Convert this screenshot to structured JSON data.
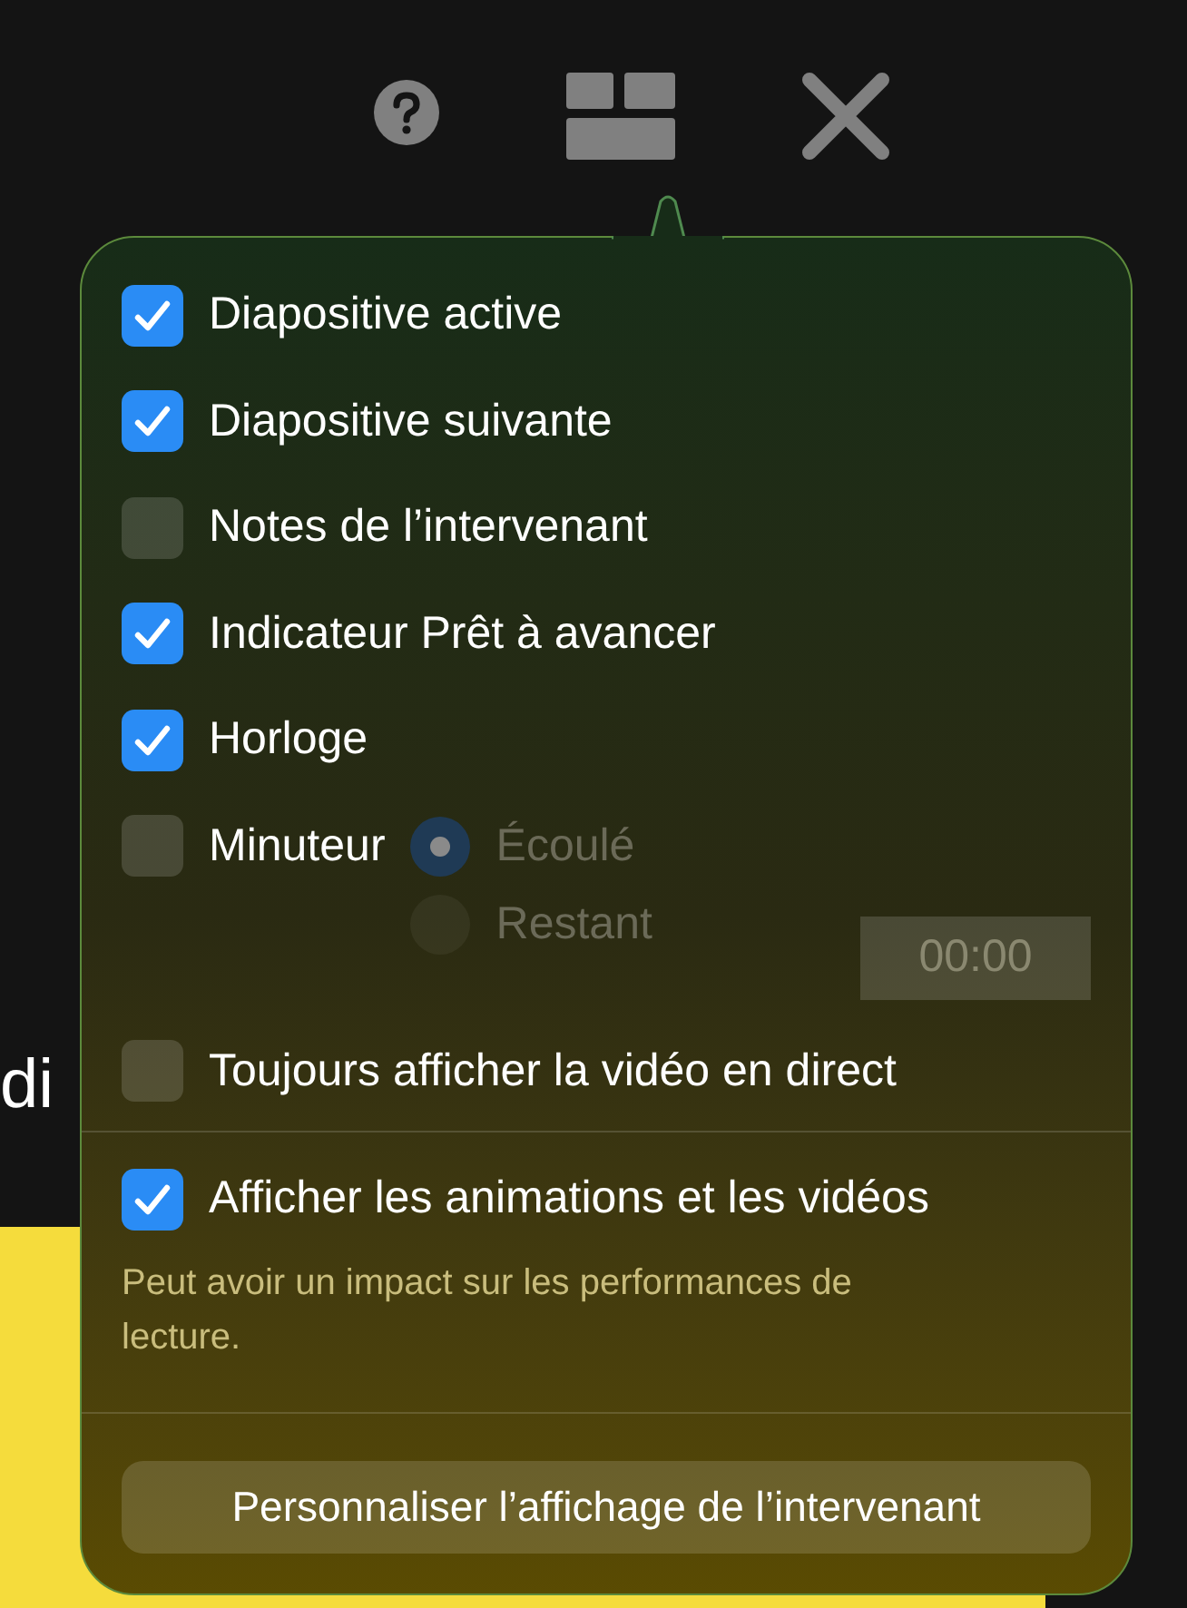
{
  "background": {
    "slide_title": "di"
  },
  "sections": [
    {
      "options": [
        {
          "kind": "checkbox",
          "label": "Diapositive active",
          "checked": true
        },
        {
          "kind": "checkbox",
          "label": "Diapositive suivante",
          "checked": true
        },
        {
          "kind": "checkbox",
          "label": "Notes de l’intervenant",
          "checked": false
        },
        {
          "kind": "checkbox",
          "label": "Indicateur Prêt à avancer",
          "checked": true
        },
        {
          "kind": "checkbox",
          "label": "Horloge",
          "checked": true
        },
        {
          "kind": "timer",
          "label": "Minuteur",
          "checked": false,
          "modes": [
            {
              "label": "Écoulé",
              "selected": true
            },
            {
              "label": "Restant",
              "selected": false
            }
          ],
          "duration": "00:00"
        },
        {
          "kind": "checkbox",
          "label": "Toujours afficher la vidéo en direct",
          "checked": false
        }
      ]
    },
    {
      "options": [
        {
          "kind": "checkbox",
          "label": "Afficher les animations et les vidéos",
          "checked": true
        }
      ],
      "note": "Peut avoir un impact sur les performances de lecture."
    }
  ],
  "button": "Personnaliser l’affichage de l’intervenant"
}
